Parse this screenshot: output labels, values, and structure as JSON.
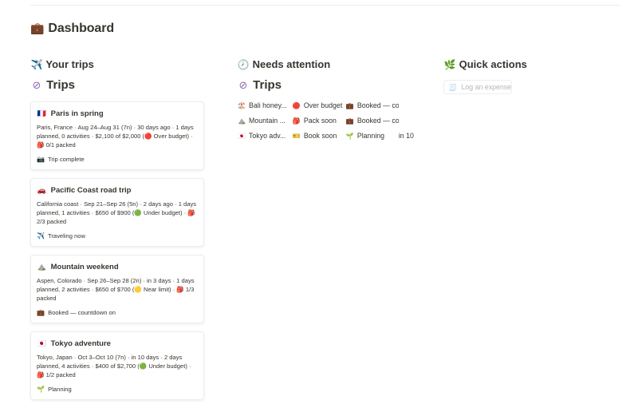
{
  "page": {
    "title": "Dashboard",
    "icon": "briefcase-icon"
  },
  "your_trips": {
    "header": "Your trips",
    "header_icon": "airplane-icon",
    "sub_header": "Trips",
    "sub_icon": "trips-database-icon",
    "cards": [
      {
        "flag": "🇫🇷",
        "name": "Paris in spring",
        "meta": "Paris, France · Aug 24–Aug 31 (7n) · 30 days ago · 1 days planned, 0 activities · $2,100 of $2,000 (🔴 Over budget) · 🎒 0/1 packed",
        "status_icon": "📷",
        "status": "Trip complete"
      },
      {
        "flag": "🚗",
        "name": "Pacific Coast road trip",
        "meta": "California coast · Sep 21–Sep 26 (5n) · 2 days ago · 1 days planned, 1 activities · $650 of $900 (🟢 Under budget) · 🎒 2/3 packed",
        "status_icon": "✈️",
        "status": "Traveling now"
      },
      {
        "flag": "⛰️",
        "name": "Mountain weekend",
        "meta": "Aspen, Colorado · Sep 26–Sep 28 (2n) · in 3 days · 1 days planned, 2 activities · $650 of $700 (🟡 Near limit) · 🎒 1/3 packed",
        "status_icon": "💼",
        "status": "Booked — countdown on"
      },
      {
        "flag": "🇯🇵",
        "name": "Tokyo adventure",
        "meta": "Tokyo, Japan · Oct 3–Oct 10 (7n) · in 10 days · 2 days planned, 4 activities · $400 of $2,700 (🟢 Under budget) · 🎒 1/2 packed",
        "status_icon": "🌱",
        "status": "Planning"
      }
    ]
  },
  "needs_attention": {
    "header": "Needs attention",
    "header_icon": "clock-icon",
    "sub_header": "Trips",
    "sub_icon": "trips-database-icon",
    "rows": [
      {
        "icon1": "🏖️",
        "trip": "Bali honey...",
        "icon2": "🔴",
        "flag": "Over budget",
        "icon3": "💼",
        "status": "Booked — cou",
        "extra": ""
      },
      {
        "icon1": "⛰️",
        "trip": "Mountain ...",
        "icon2": "🎒",
        "flag": "Pack soon",
        "icon3": "💼",
        "status": "Booked — count",
        "extra": ""
      },
      {
        "icon1": "🇯🇵",
        "trip": "Tokyo adv...",
        "icon2": "🎫",
        "flag": "Book soon",
        "icon3": "🌱",
        "status": "Planning",
        "extra": "in 10"
      }
    ]
  },
  "quick_actions": {
    "header": "Quick actions",
    "header_icon": "herb-icon",
    "button_icon": "receipt-icon",
    "button_label": "Log an expense"
  }
}
